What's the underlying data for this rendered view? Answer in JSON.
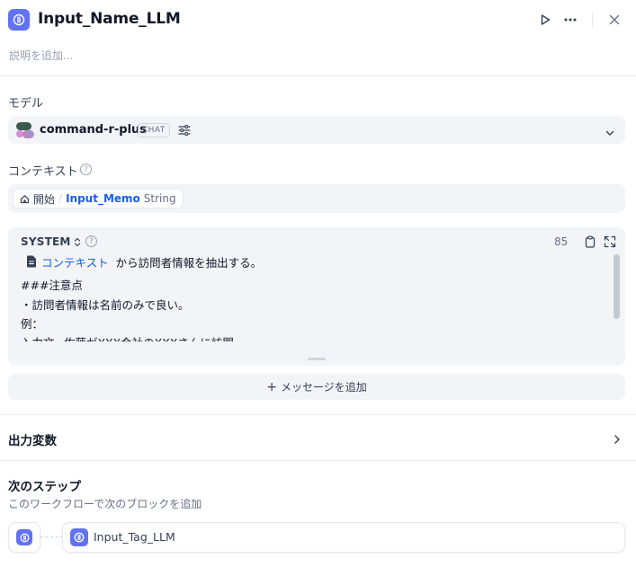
{
  "header": {
    "title": "Input_Name_LLM",
    "description_placeholder": "説明を追加..."
  },
  "model": {
    "section_label": "モデル",
    "name": "command-r-plus",
    "mode_badge": "CHAT"
  },
  "context": {
    "section_label": "コンテキスト",
    "variable": {
      "node": "開始",
      "separator": "/",
      "name": "Input_Memo",
      "type": "String"
    }
  },
  "prompt": {
    "role": "SYSTEM",
    "char_count": "85",
    "context_tag": "コンテキスト",
    "first_line_text": "から訪問者情報を抽出する。",
    "lines": [
      "###注意点",
      "・訪問者情報は名前のみで良い。",
      "例：",
      "入力文~佐藤がXXX会社のXXXさんに訪問"
    ]
  },
  "add_message_label": "メッセージを追加",
  "output_variables": {
    "label": "出力変数"
  },
  "next_step": {
    "label": "次のステップ",
    "sublabel": "このワークフローで次のブロックを追加",
    "next_block_name": "Input_Tag_LLM"
  },
  "colors": {
    "accent": "#6172f3",
    "link": "#155eef",
    "panel_bg": "#f2f4f7"
  }
}
